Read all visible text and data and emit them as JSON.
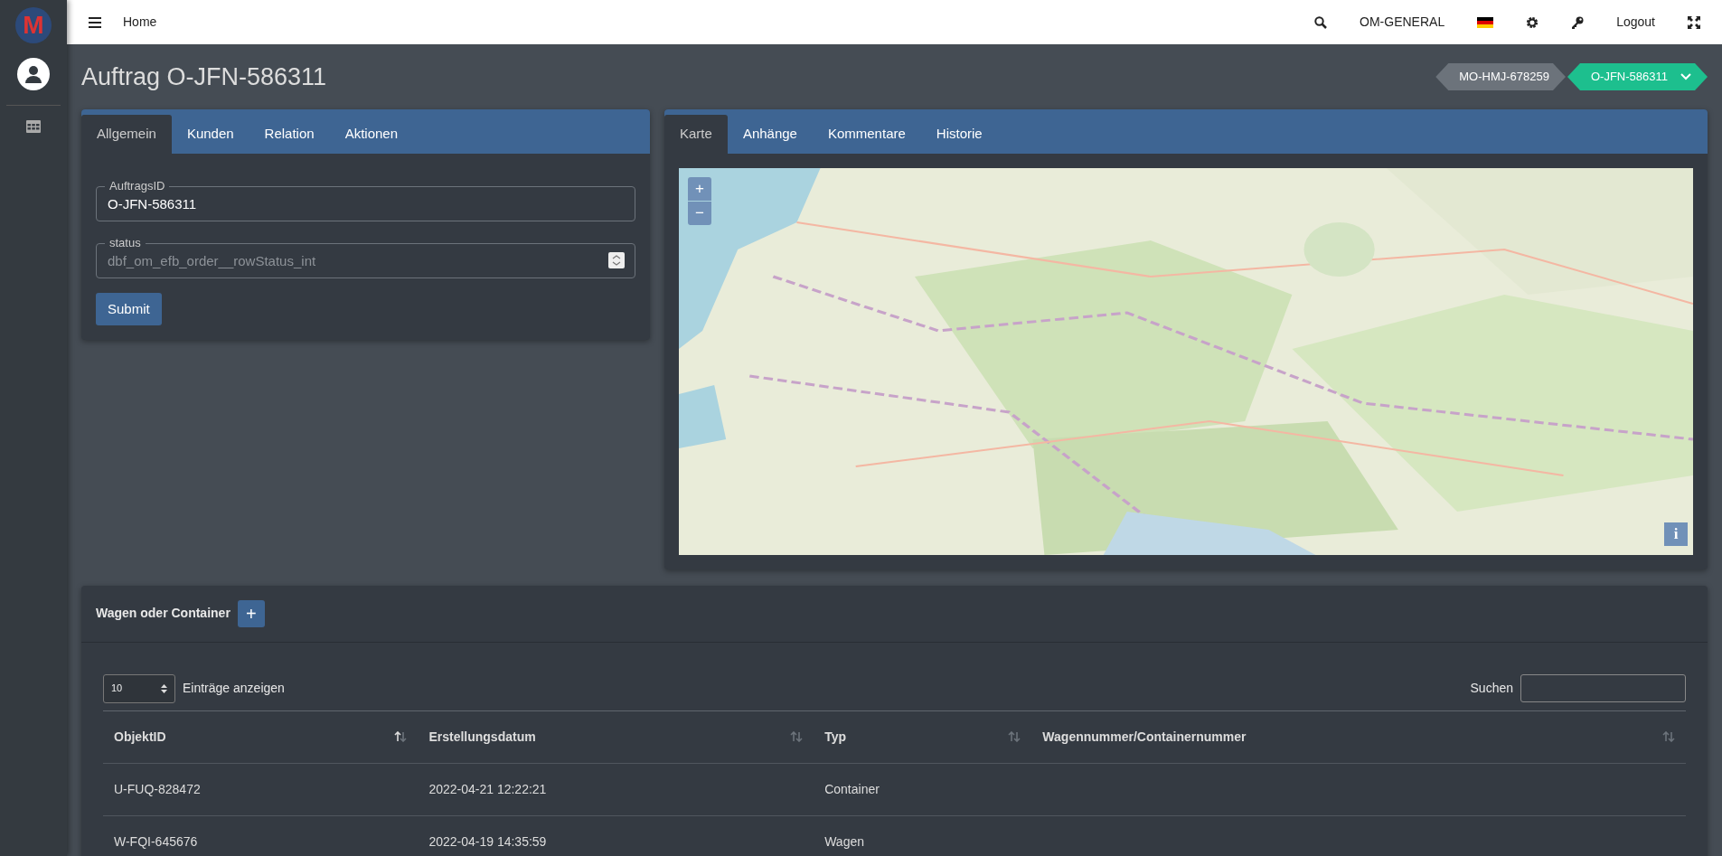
{
  "sidebar": {
    "logo_text": "M"
  },
  "navbar": {
    "home": "Home",
    "workspace": "OM-GENERAL",
    "logout": "Logout"
  },
  "page": {
    "title": "Auftrag O-JFN-586311"
  },
  "breadcrumbs": [
    {
      "label": "MO-HMJ-678259",
      "selected": false
    },
    {
      "label": "O-JFN-586311",
      "selected": true
    }
  ],
  "left_tabs": [
    {
      "label": "Allgemein",
      "selected": true
    },
    {
      "label": "Kunden",
      "selected": false
    },
    {
      "label": "Relation",
      "selected": false
    },
    {
      "label": "Aktionen",
      "selected": false
    }
  ],
  "form": {
    "fields": [
      {
        "kind": "text",
        "label": "AuftragsID",
        "value": "O-JFN-586311"
      },
      {
        "kind": "number",
        "label": "status",
        "placeholder": "dbf_om_efb_order__rowStatus_int"
      }
    ],
    "submit": "Submit"
  },
  "right_tabs": [
    {
      "label": "Karte",
      "selected": true
    },
    {
      "label": "Anhänge",
      "selected": false
    },
    {
      "label": "Kommentare",
      "selected": false
    },
    {
      "label": "Historie",
      "selected": false
    }
  ],
  "map": {
    "zoom_in": "+",
    "zoom_out": "−",
    "info": "i"
  },
  "table_card": {
    "title": "Wagen oder Container",
    "add": "+",
    "page_size": "10",
    "page_size_label": "Einträge anzeigen",
    "search_label": "Suchen",
    "columns": [
      {
        "label": "ObjektID",
        "sorted": true
      },
      {
        "label": "Erstellungsdatum",
        "sorted": false
      },
      {
        "label": "Typ",
        "sorted": false
      },
      {
        "label": "Wagennummer/Containernummer",
        "sorted": false
      }
    ],
    "rows": [
      [
        "U-FUQ-828472",
        "2022-04-21 12:22:21",
        "Container",
        ""
      ],
      [
        "W-FQI-645676",
        "2022-04-19 14:35:59",
        "Wagen",
        ""
      ]
    ]
  }
}
